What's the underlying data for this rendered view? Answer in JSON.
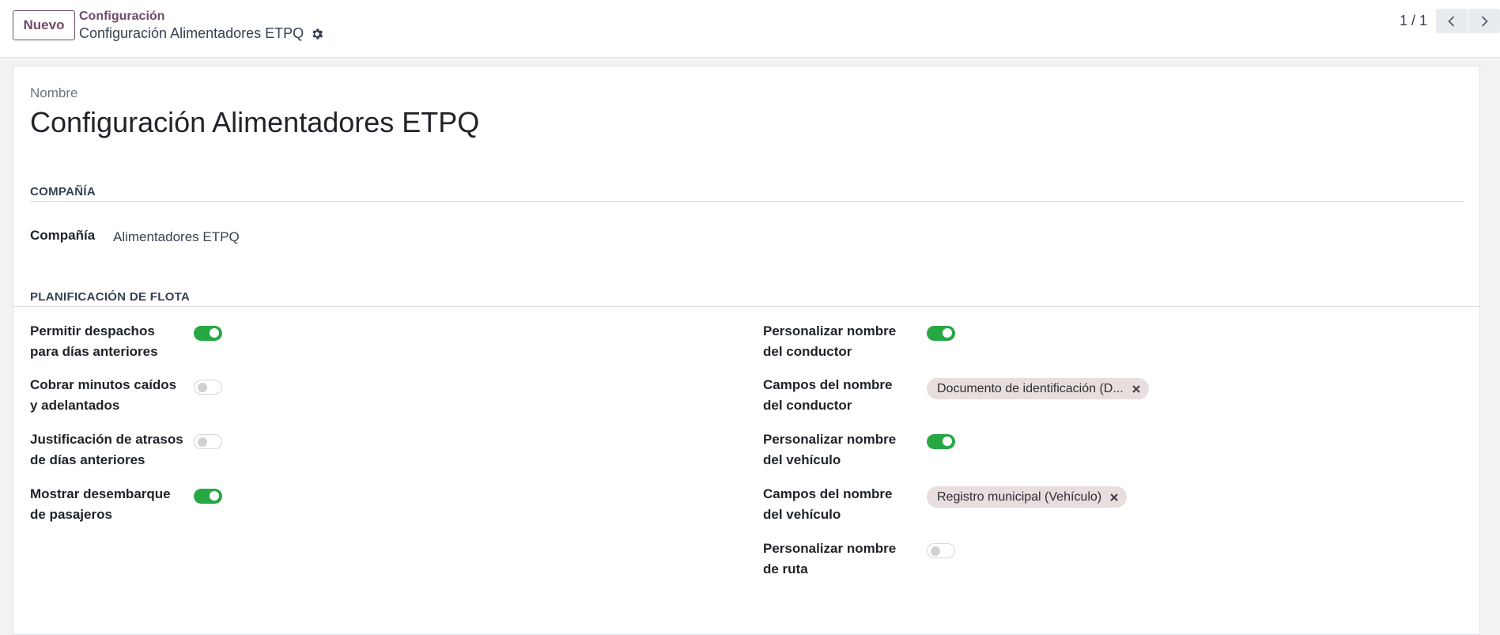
{
  "control_panel": {
    "new_button": "Nuevo",
    "breadcrumb": "Configuración",
    "record_title": "Configuración Alimentadores ETPQ",
    "pager": "1 / 1"
  },
  "form": {
    "name_label": "Nombre",
    "name_value": "Configuración Alimentadores ETPQ",
    "company_section": {
      "title": "COMPAÑÍA",
      "company_label": "Compañía",
      "company_value": "Alimentadores ETPQ"
    },
    "fleet_section": {
      "title": "PLANIFICACIÓN DE FLOTA",
      "left_fields": [
        {
          "line1": "Permitir despachos",
          "line2": "para días anteriores",
          "enabled": true
        },
        {
          "line1": "Cobrar minutos caídos",
          "line2": "y adelantados",
          "enabled": false
        },
        {
          "line1": "Justificación de atrasos",
          "line2": "de días anteriores",
          "enabled": false
        },
        {
          "line1": "Mostrar desembarque",
          "line2": "de pasajeros",
          "enabled": true
        }
      ],
      "right_fields": {
        "driver_custom": {
          "line1": "Personalizar nombre",
          "line2": "del conductor",
          "enabled": true
        },
        "driver_fields": {
          "line1": "Campos del nombre",
          "line2": "del conductor",
          "tag": "Documento de identificación (D..."
        },
        "vehicle_custom": {
          "line1": "Personalizar nombre",
          "line2": "del vehículo",
          "enabled": true
        },
        "vehicle_fields": {
          "line1": "Campos del nombre",
          "line2": "del vehículo",
          "tag": "Registro municipal (Vehículo)"
        },
        "route_custom": {
          "line1": "Personalizar nombre",
          "line2": "de ruta",
          "enabled": false
        }
      }
    }
  },
  "colors": {
    "brand": "#714b67",
    "toggle_on": "#28a745",
    "tag_bg": "#e7dedd"
  }
}
